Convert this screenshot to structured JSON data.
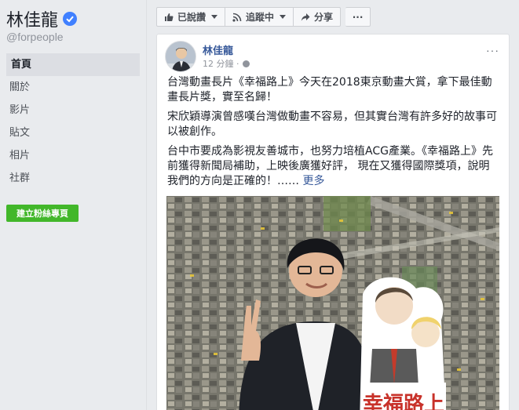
{
  "sidebar": {
    "page_name": "林佳龍",
    "handle": "@forpeople",
    "nav": [
      "首頁",
      "關於",
      "影片",
      "貼文",
      "相片",
      "社群"
    ],
    "create_button": "建立粉絲專頁"
  },
  "action_bar": {
    "liked": "已說讚",
    "following": "追蹤中",
    "share": "分享",
    "more": "···"
  },
  "post": {
    "author": "林佳龍",
    "time": "12 分鐘 ·",
    "menu": "···",
    "paragraphs": [
      "台灣動畫長片《幸福路上》今天在2018東京動畫大賞，拿下最佳動畫長片獎，實至名歸！",
      "宋欣穎導演曾感嘆台灣做動畫不容易，但其實台灣有許多好的故事可以被創作。",
      "台中市要成為影視友善城市，也努力培植ACG產業。《幸福路上》先前獲得新聞局補助，上映後廣獲好評， 現在又獲得國際獎項，說明我們的方向是正確的！……"
    ],
    "more_link": "更多",
    "photo_sign_text": "幸福路上"
  },
  "colors": {
    "link_blue": "#365899",
    "verified_blue": "#4080ff",
    "create_green": "#42b72a"
  }
}
